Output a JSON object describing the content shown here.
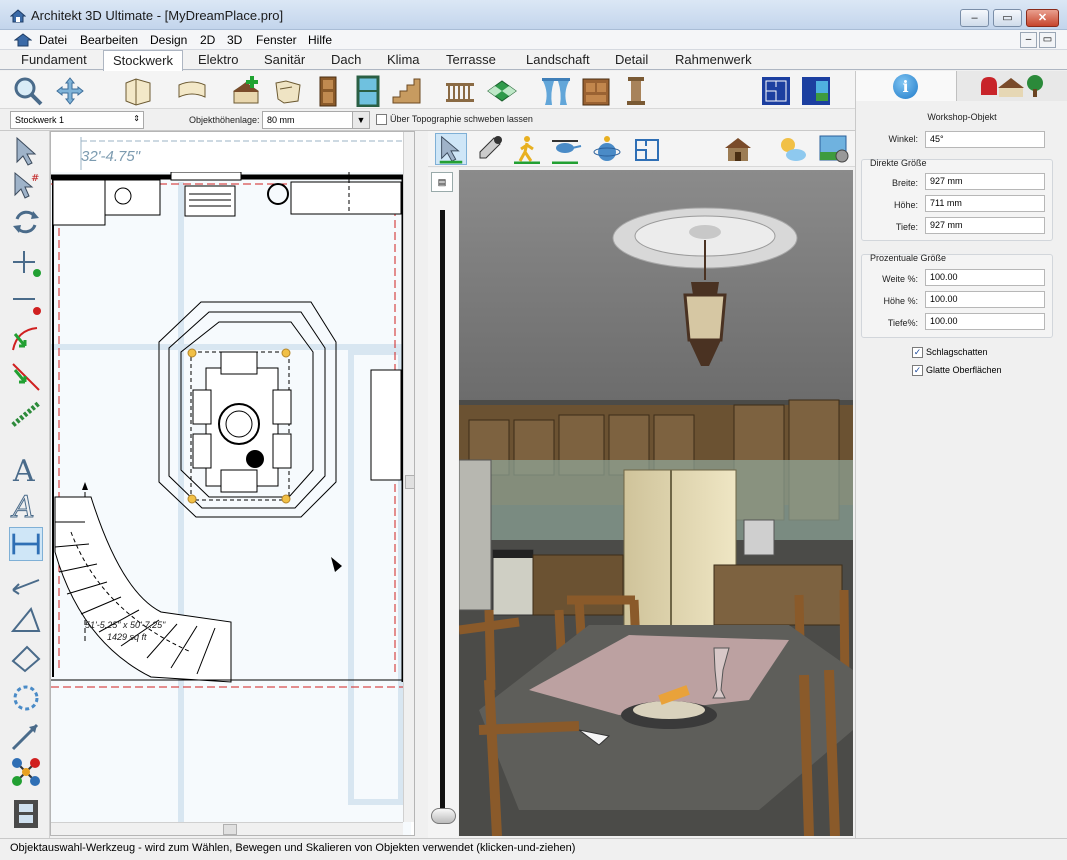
{
  "window": {
    "app_name": "Architekt 3D Ultimate - ",
    "document": "[MyDreamPlace.pro]",
    "minimize": "–",
    "maximize": "▭",
    "close": "✕"
  },
  "menu": {
    "items": [
      "Datei",
      "Bearbeiten",
      "Design",
      "2D",
      "3D",
      "Fenster",
      "Hilfe"
    ]
  },
  "tabs": {
    "items": [
      "Fundament",
      "Stockwerk",
      "Elektro",
      "Sanitär",
      "Dach",
      "Klima",
      "Terrasse",
      "Landschaft",
      "Detail",
      "Rahmenwerk"
    ],
    "active": "Stockwerk"
  },
  "options": {
    "floor_select": "Stockwerk 1",
    "height_label": "Objekthöhenlage:",
    "height_value": "80 mm",
    "float_label": "Über Topographie schweben lassen"
  },
  "plan": {
    "ruler_label": "32'-4.75\"",
    "area_label_1": "51'-5.25\" x 50'-7.25\"",
    "area_label_2": "1429 sq ft"
  },
  "properties": {
    "object_title": "Workshop-Objekt",
    "angle_label": "Winkel:",
    "angle_value": "45°",
    "direct_size": {
      "title": "Direkte Größe",
      "width_label": "Breite:",
      "width_value": "927 mm",
      "height_label": "Höhe:",
      "height_value": "711 mm",
      "depth_label": "Tiefe:",
      "depth_value": "927 mm"
    },
    "percent_size": {
      "title": "Prozentuale Größe",
      "width_label": "Weite %:",
      "width_value": "100.00",
      "height_label": "Höhe %:",
      "height_value": "100.00",
      "depth_label": "Tiefe%:",
      "depth_value": "100.00"
    },
    "shadows_label": "Schlagschatten",
    "smooth_label": "Glatte Oberflächen"
  },
  "status": {
    "text": "Objektauswahl-Werkzeug - wird zum Wählen, Bewegen und Skalieren von Objekten verwendet (klicken-und-ziehen)"
  },
  "icons": {
    "toolbar": [
      "zoom-icon",
      "pan-icon",
      "wall-icon",
      "curved-wall-icon",
      "add-room-icon",
      "trace-icon",
      "door-icon",
      "window-icon",
      "stairs-icon",
      "railing-icon",
      "floor-material-icon",
      "curtain-icon",
      "cabinet-icon",
      "column-icon",
      "plan-view-icon",
      "split-view-icon"
    ],
    "colors": {
      "accent": "#1f7ac8",
      "titlebar": "#c3d5ec",
      "plan_line": "#000000",
      "plan_dim": "#d02020"
    }
  }
}
